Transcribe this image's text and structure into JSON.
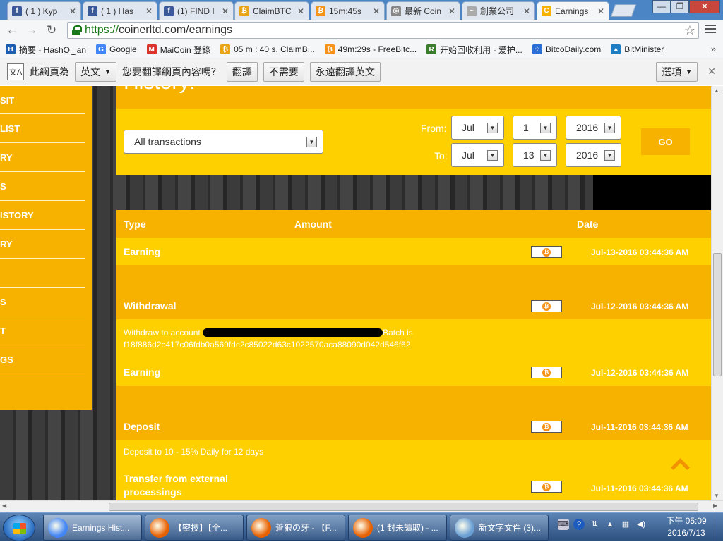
{
  "browser": {
    "tabs": [
      {
        "title": "( 1 ) Kyp",
        "color": "#3b5998",
        "glyph": "f"
      },
      {
        "title": "( 1 ) Has",
        "color": "#3b5998",
        "glyph": "f"
      },
      {
        "title": "(1) FIND I",
        "color": "#3b5998",
        "glyph": "f"
      },
      {
        "title": "ClaimBTC",
        "color": "#e8a317",
        "glyph": "₿"
      },
      {
        "title": "15m:45s",
        "color": "#f7931a",
        "glyph": "₿"
      },
      {
        "title": "最新 Coin",
        "color": "#888888",
        "glyph": "◎"
      },
      {
        "title": "創業公司",
        "color": "#aaaaaa",
        "glyph": "~"
      },
      {
        "title": "Earnings",
        "color": "#f7b200",
        "glyph": "C"
      }
    ],
    "url_scheme": "https://",
    "url_rest": "coinerltd.com/earnings"
  },
  "bookmarks": [
    {
      "label": "摘要 - HashO‿an",
      "color": "#1a5fb4",
      "glyph": "H"
    },
    {
      "label": "Google",
      "color": "#4285f4",
      "glyph": "G"
    },
    {
      "label": "MaiCoin 登錄",
      "color": "#d9352b",
      "glyph": "M"
    },
    {
      "label": "05 m : 40 s. ClaimB...",
      "color": "#e8a317",
      "glyph": "₿"
    },
    {
      "label": "49m:29s - FreeBitc...",
      "color": "#f7931a",
      "glyph": "₿"
    },
    {
      "label": "开始回收利用 - 爱护...",
      "color": "#3a7d2c",
      "glyph": "R"
    },
    {
      "label": "BitcoDaily.com",
      "color": "#2a6fd6",
      "glyph": "⁘"
    },
    {
      "label": "BitMinister",
      "color": "#1d7dc4",
      "glyph": "▲"
    }
  ],
  "translate_bar": {
    "prefix": "此網頁為",
    "language": "英文",
    "question": "您要翻譯網頁內容嗎？",
    "translate": "翻譯",
    "no": "不需要",
    "always": "永遠翻譯英文",
    "options": "選項"
  },
  "sidebar": [
    "SIT",
    "LIST",
    "RY",
    "S",
    "ISTORY",
    "RY",
    "",
    "S",
    "T",
    "GS"
  ],
  "page": {
    "heading_partial": "History:",
    "filter": {
      "type_value": "All transactions",
      "from_label": "From:",
      "to_label": "To:",
      "from_month": "Jul",
      "from_day": "1",
      "from_year": "2016",
      "to_month": "Jul",
      "to_day": "13",
      "to_year": "2016",
      "go": "GO"
    },
    "columns": {
      "type": "Type",
      "amount": "Amount",
      "date": "Date"
    },
    "rows": [
      {
        "type": "Earning",
        "date": "Jul-13-2016 03:44:36 AM",
        "detail": "",
        "detail_hash": "",
        "shade": "ya",
        "detail_h": 38
      },
      {
        "type": "Withdrawal",
        "date": "Jul-12-2016 03:44:36 AM",
        "detail": "Withdraw to account",
        "detail_suffix": "Batch is",
        "detail_hash": "f18f886d2c417c06fdb0a569fdc2c85022d63c1022570aca88090d042d546f62",
        "shade": "yb",
        "detail_h": 55
      },
      {
        "type": "Earning",
        "date": "Jul-12-2016 03:44:36 AM",
        "detail": "",
        "detail_hash": "",
        "shade": "ya",
        "detail_h": 38
      },
      {
        "type": "Deposit",
        "date": "Jul-11-2016 03:44:36 AM",
        "detail": "Deposit to 10 - 15% Daily for 12 days",
        "detail_hash": "",
        "shade": "yb",
        "detail_h": 38
      },
      {
        "type": "Transfer from external processings",
        "date": "Jul-11-2016 03:44:36 AM",
        "detail": "",
        "detail_hash": "",
        "shade": "ya",
        "detail_h": 0
      }
    ]
  },
  "taskbar": {
    "items": [
      {
        "label": "Earnings Hist...",
        "color": "#4285f4"
      },
      {
        "label": "【密技】【全...",
        "color": "#e66000"
      },
      {
        "label": "蒼狼の牙 - 【F...",
        "color": "#e66000"
      },
      {
        "label": "(1 封未讀取) - ...",
        "color": "#e66000"
      },
      {
        "label": "新文字文件 (3)...",
        "color": "#6a9fd4"
      }
    ],
    "clock_time": "下午 05:09",
    "clock_date": "2016/7/13"
  }
}
